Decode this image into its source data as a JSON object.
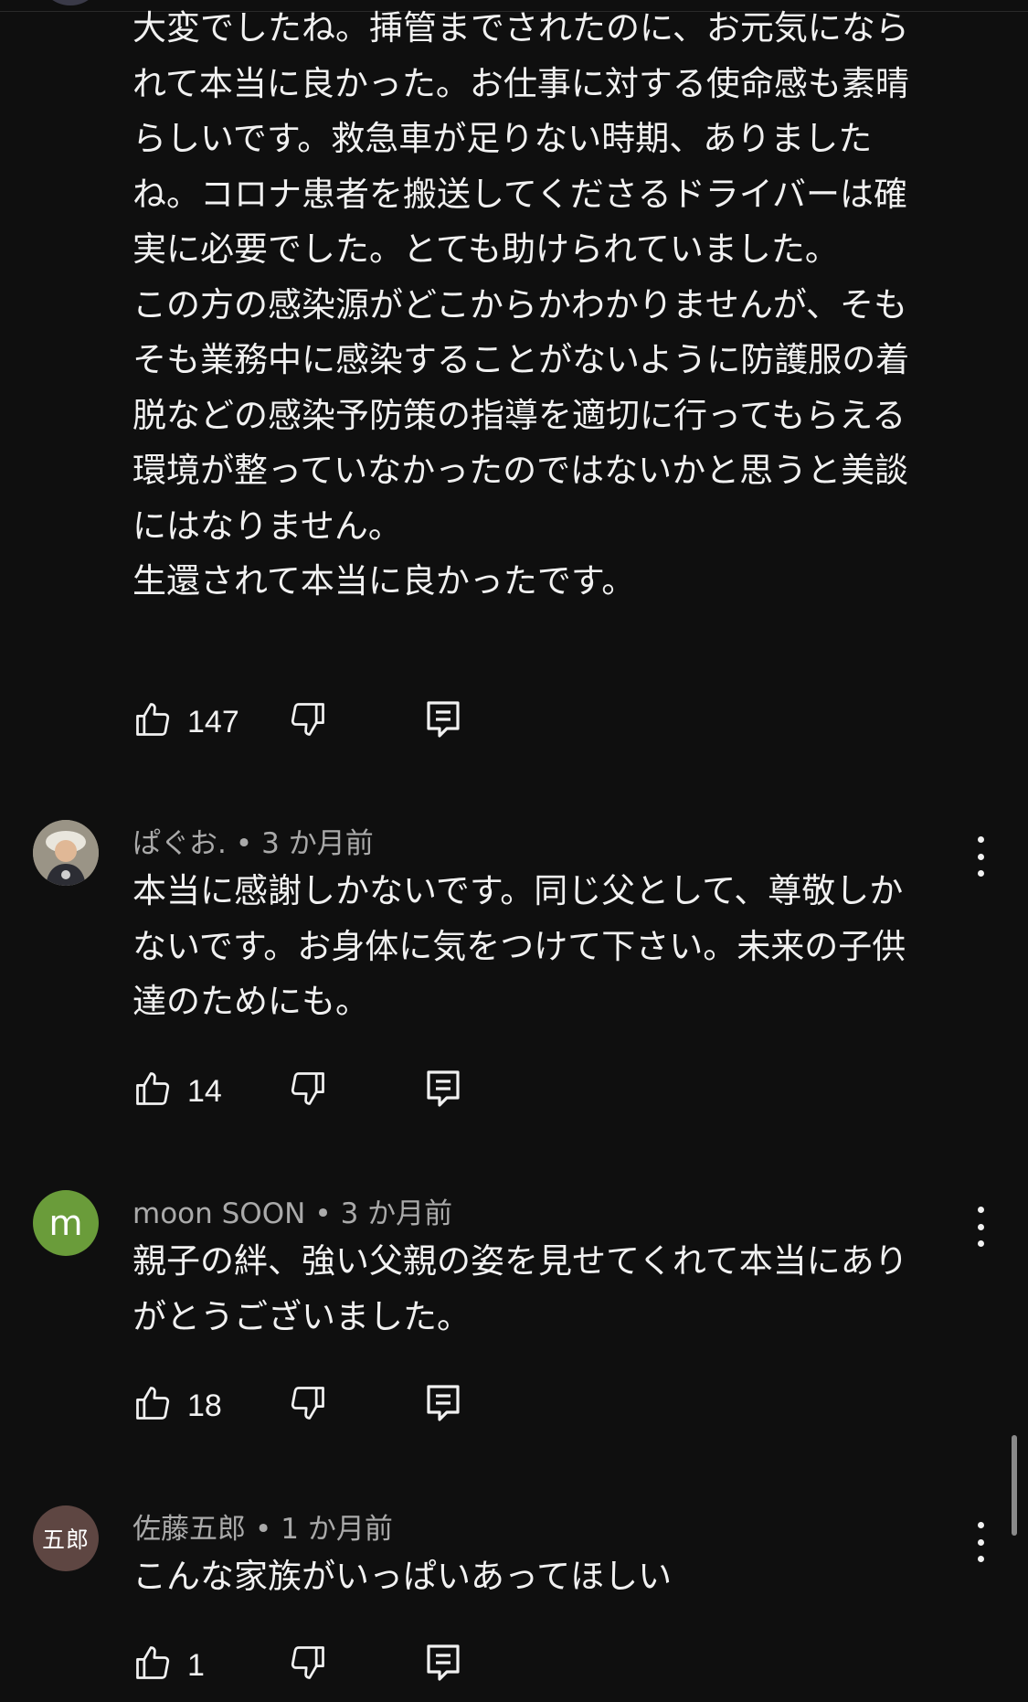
{
  "comments": [
    {
      "text": "大変でしたね。挿管までされたのに、お元気になられて本当に良かった。お仕事に対する使命感も素晴らしいです。救急車が足りない時期、ありましたね。コロナ患者を搬送してくださるドライバーは確実に必要でした。とても助けられていました。\nこの方の感染源がどこからかわかりませんが、そもそも業務中に感染することがないように防護服の着脱などの感染予防策の指導を適切に行ってもらえる環境が整っていなかったのではないかと思うと美談にはなりません。\n生還されて本当に良かったです。",
      "likes": "147"
    },
    {
      "author": "ぱぐお.",
      "time": "3 か月前",
      "avatar_icon": "child-photo-avatar",
      "text": "本当に感謝しかないです。同じ父として、尊敬しかないです。お身体に気をつけて下さい。未来の子供達のためにも。",
      "likes": "14"
    },
    {
      "author": "moon SOON",
      "time": "3 か月前",
      "avatar_letter": "m",
      "avatar_color": "#6a9c3a",
      "text": "親子の絆、強い父親の姿を見せてくれて本当にありがとうございました。",
      "likes": "18"
    },
    {
      "author": "佐藤五郎",
      "time": "1 か月前",
      "avatar_letter": "五郎",
      "avatar_color": "#5e4642",
      "text": "こんな家族がいっぱいあってほしい",
      "likes": "1"
    }
  ],
  "icons": {
    "like": "thumbs-up-icon",
    "dislike": "thumbs-down-icon",
    "reply": "reply-icon",
    "more": "more-vert-icon"
  }
}
